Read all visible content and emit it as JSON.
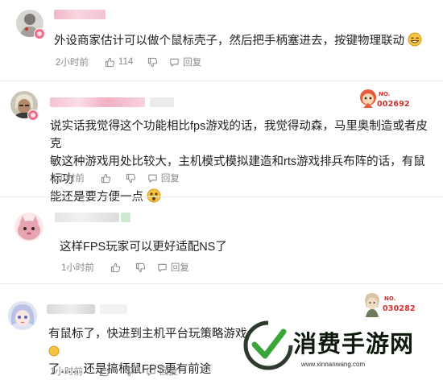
{
  "comments": [
    {
      "text_lines": [
        "外设商家估计可以做个鼠标壳子，然后把手柄塞进去，按键物理联动"
      ],
      "time": "2小时前",
      "likes": "114",
      "reply_label": "回复",
      "emoji": "grin-emoji"
    },
    {
      "text_lines": [
        "说实话我觉得这个功能相比fps游戏的话，我觉得动森，马里奥制造或者皮克",
        "敏这种游戏用处比较大，主机模式模拟建造和rts游戏排兵布阵的话，有鼠标功",
        "能还是要方便一点"
      ],
      "time": "1小时前",
      "likes": "",
      "reply_label": "回复",
      "badge_number": "002692",
      "badge_prefix": "NO.",
      "emoji": "surprised-emoji"
    },
    {
      "text_lines": [
        "这样FPS玩家可以更好适配NS了"
      ],
      "time": "1小时前",
      "likes": "",
      "reply_label": "回复"
    },
    {
      "text_lines": [
        "有鼠标了，快进到主机平台玩策略游戏",
        "了……还是搞柄鼠FPS更有前途"
      ],
      "time": "1小时前",
      "likes": "",
      "reply_label": "回复",
      "badge_number": "030282",
      "badge_prefix": "NO."
    }
  ],
  "watermark": {
    "title": "消费手游网",
    "url": "www.xinnanwang.com"
  },
  "colors": {
    "text": "#222222",
    "meta": "#8a8a8a",
    "badge_red": "#d42f2f",
    "watermark_green": "#3aa63a"
  }
}
